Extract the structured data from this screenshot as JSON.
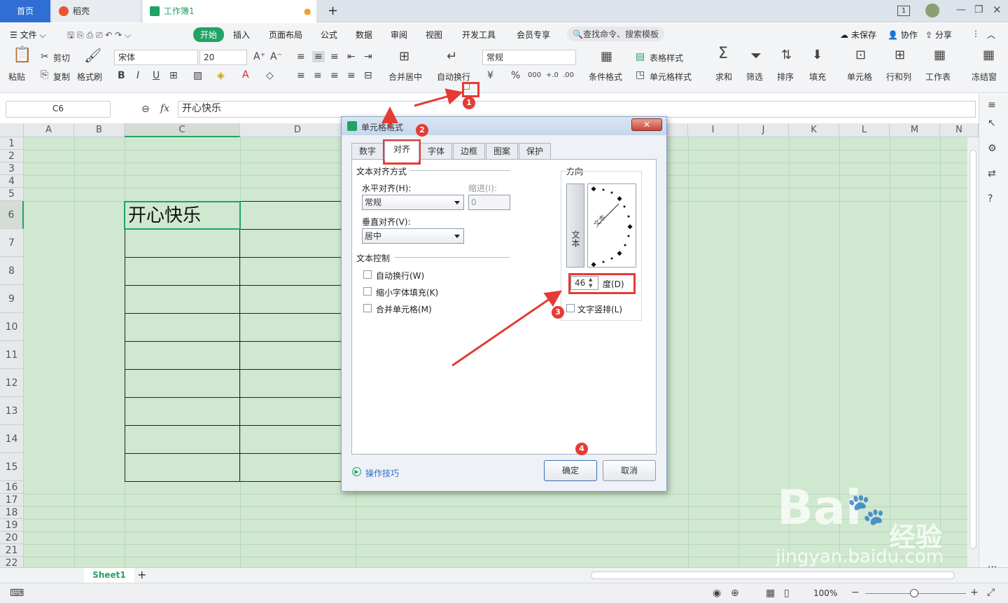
{
  "tabs": {
    "home": "首页",
    "daoke": "稻壳",
    "book": "工作簿1",
    "new_tab": "+",
    "page_indicator": "1"
  },
  "menu": {
    "file": "文件",
    "items": [
      "开始",
      "插入",
      "页面布局",
      "公式",
      "数据",
      "审阅",
      "视图",
      "开发工具",
      "会员专享"
    ],
    "search": "查找命令、搜索模板",
    "unsaved": "未保存",
    "collab": "协作",
    "share": "分享"
  },
  "ribbon": {
    "paste": "粘贴",
    "cut": "剪切",
    "copy": "复制",
    "format_painter": "格式刷",
    "font": "宋体",
    "size": "20",
    "merge": "合并居中",
    "wrap": "自动换行",
    "number_format": "常规",
    "percent": "%",
    "cond_format": "条件格式",
    "table_style": "表格样式",
    "cell_style": "单元格样式",
    "sum": "求和",
    "filter": "筛选",
    "sort": "排序",
    "fill": "填充",
    "cell": "单元格",
    "rowcol": "行和列",
    "sheet": "工作表",
    "freeze": "冻结窗"
  },
  "formula": {
    "name_box": "C6",
    "fx": "fx",
    "content": "开心快乐"
  },
  "sheet": {
    "cols": [
      "A",
      "B",
      "C",
      "D",
      "I",
      "J",
      "K",
      "L",
      "M",
      "N"
    ],
    "rows": [
      "1",
      "2",
      "3",
      "4",
      "5",
      "6",
      "7",
      "8",
      "9",
      "10",
      "11",
      "12",
      "13",
      "14",
      "15",
      "16",
      "17",
      "18",
      "19",
      "20",
      "21",
      "22"
    ],
    "cell_c6": "开心快乐",
    "sheet_tab": "Sheet1"
  },
  "status": {
    "zoom": "100%"
  },
  "dialog": {
    "title": "单元格格式",
    "tabs": [
      "数字",
      "对齐",
      "字体",
      "边框",
      "图案",
      "保护"
    ],
    "align_group": "文本对齐方式",
    "h_align_label": "水平对齐(H):",
    "h_align_value": "常规",
    "indent_label": "缩进(I):",
    "indent_value": "0",
    "v_align_label": "垂直对齐(V):",
    "v_align_value": "居中",
    "control_group": "文本控制",
    "wrap": "自动换行(W)",
    "shrink": "缩小字体填充(K)",
    "merge": "合并单元格(M)",
    "orientation_group": "方向",
    "vertical_text": "文本",
    "orientation_text": "文本",
    "degrees_value": "46",
    "degrees_label": "度(D)",
    "stack_text": "文字竖排(L)",
    "tips": "操作技巧",
    "ok": "确定",
    "cancel": "取消"
  },
  "badges": [
    "1",
    "2",
    "3",
    "4"
  ],
  "watermark": {
    "brand": "Bai",
    "brand2": "经验",
    "url": "jingyan.baidu.com"
  }
}
